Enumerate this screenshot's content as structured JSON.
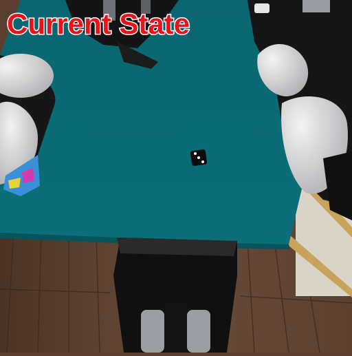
{
  "overlay": {
    "title": "Current State",
    "title_color": "#e8141c"
  },
  "scene": {
    "table_color": "#0b6b75",
    "floor_color": "#6a4a38",
    "objects": [
      "robot-arm-left",
      "robot-arm-right",
      "gripper",
      "die",
      "toy-box",
      "robot-base"
    ]
  }
}
